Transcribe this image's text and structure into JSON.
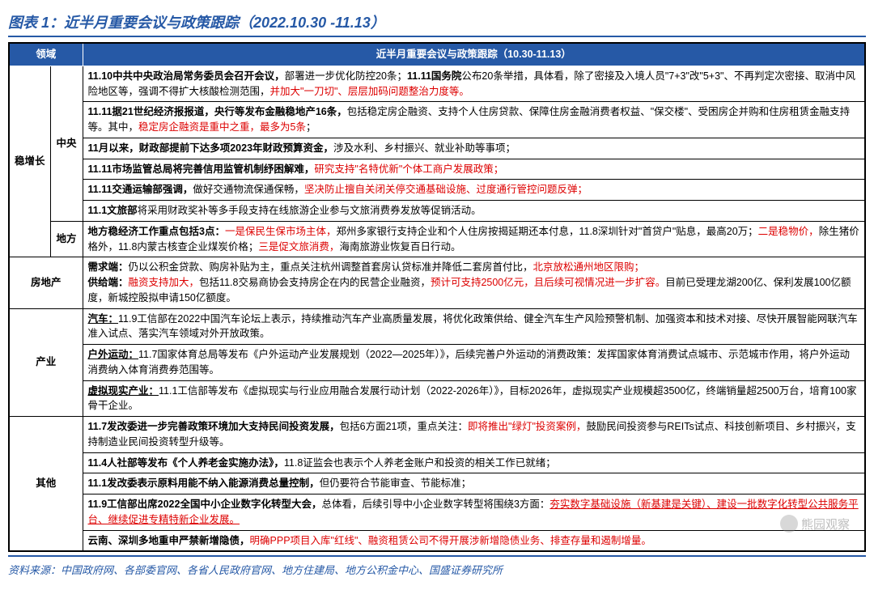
{
  "title": "图表 1：近半月重要会议与政策跟踪（2022.10.30 -11.13）",
  "header": {
    "col1": "领域",
    "col2": "近半月重要会议与政策跟踪（10.30-11.13）"
  },
  "source": "资料来源：中国政府网、各部委官网、各省人民政府官网、地方住建局、地方公积金中心、国盛证券研究所",
  "watermark": "熊园观察",
  "cat": {
    "wzz": "稳增长",
    "zy": "中央",
    "df": "地方",
    "fdc": "房地产",
    "cy": "产业",
    "qt": "其他"
  },
  "rows": {
    "zy1_b1": "11.10中共中央政治局常务委员会召开会议，",
    "zy1_t1": "部署进一步优化防控20条；",
    "zy1_b2": "11.11国务院",
    "zy1_t2": "公布20条举措，具体看，除了密接及入境人员\"7+3\"改\"5+3\"、不再判定次密接、取消中风险地区等，强调不得扩大核酸检测范围，",
    "zy1_r1": "并加大\"一刀切\"、层层加码问题整治力度等。",
    "zy2_b1": "11.11据21世纪经济报报道，央行等发布金融稳地产16条，",
    "zy2_t1": "包括稳定房企融资、支持个人住房贷款、保障住房金融消费者权益、\"保交楼\"、受困房企并购和住房租赁金融支持等。其中，",
    "zy2_r1": "稳定房企融资是重中之重，最多为5条",
    "zy2_t2": "；",
    "zy3_b1": "11月以来，财政部提前下达多项2023年财政预算资金，",
    "zy3_t1": "涉及水利、乡村振兴、就业补助等事项；",
    "zy4_b1": "11.11市场监管总局将完善信用监管机制纾困解难，",
    "zy4_r1": "研究支持\"名特优新\"个体工商户发展政策；",
    "zy5_b1": "11.11交通运输部强调，",
    "zy5_t1": "做好交通物流保通保畅，",
    "zy5_r1": "坚决防止擅自关闭关停交通基础设施、过度通行管控问题反弹；",
    "zy6_b1": "11.1文旅部",
    "zy6_t1": "将采用财政奖补等多手段支持在线旅游企业参与文旅消费券发放等促销活动。",
    "df1_b1": "地方稳经济工作重点包括3点：",
    "df1_r1": "一是保民生保市场主体，",
    "df1_t1": "郑州多家银行支持企业和个人住房按揭延期还本付息，11.8深圳针对\"首贷户\"贴息，最高20万；",
    "df1_r2": "二是稳物价，",
    "df1_t2": "除生猪价格外，11.8内蒙古核查企业煤炭价格；",
    "df1_r3": "三是促文旅消费，",
    "df1_t3": "海南旅游业恢复百日行动。",
    "fdc_b1": "需求端：",
    "fdc_t1": "仍以公积金贷款、购房补贴为主，重点关注杭州调整首套房认贷标准并降低二套房首付比，",
    "fdc_r1": "北京放松通州地区限购；",
    "fdc_b2": "供给端：",
    "fdc_r2": "融资支持加大，",
    "fdc_t2": "包括11.8交易商协会支持房企在内的民营企业融资，",
    "fdc_r3": "预计可支持2500亿元，且后续可视情况进一步扩容。",
    "fdc_t3": "目前已受理龙湖200亿、保利发展100亿额度，新城控股拟申请150亿额度。",
    "cy1_bu": "汽车：",
    "cy1_t1": "11.9工信部在2022中国汽车论坛上表示，持续推动汽车产业高质量发展，将优化政策供给、健全汽车生产风险预警机制、加强资本和技术对接、尽快开展智能网联汽车准入试点、落实汽车领域对外开放政策。",
    "cy2_bu": "户外运动：",
    "cy2_t1": "11.7国家体育总局等发布《户外运动产业发展规划（2022—2025年）》，后续完善户外运动的消费政策：发挥国家体育消费试点城市、示范城市作用，将户外运动消费纳入体育消费券范围等。",
    "cy3_bu": "虚拟现实产业：",
    "cy3_t1": "11.1工信部等发布《虚拟现实与行业应用融合发展行动计划（2022-2026年）》，目标2026年，虚拟现实产业规模超3500亿，终端销量超2500万台，培育100家骨干企业。",
    "qt1_b1": "11.7发改委进一步完善政策环境加大支持民间投资发展，",
    "qt1_t1": "包括6方面21项，重点关注：",
    "qt1_r1": "即将推出\"绿灯\"投资案例，",
    "qt1_t2": "鼓励民间投资参与REITs试点、科技创新项目、乡村振兴，支持制造业民间投资转型升级等。",
    "qt2_b1": "11.4人社部等发布《个人养老金实施办法》，",
    "qt2_t1": "11.8证监会也表示个人养老金账户和投资的相关工作已就绪；",
    "qt3_b1": "11.1发改委表示原料用能不纳入能源消费总量控制，",
    "qt3_t1": "但仍要符合节能审查、节能标准；",
    "qt4_b1": "11.9工信部出席2022全国中小企业数字化转型大会，",
    "qt4_t1": "总体看，后续引导中小企业数字转型将围绕3方面：",
    "qt4_r1": "夯实数字基础设施（新基建是关键）、建设一批数字化转型公共服务平台、继续促进专精特新企业发展。",
    "qt5_b1": "云南、深圳多地重申严禁新增隐债，",
    "qt5_r1": "明确PPP项目入库\"红线\"、融资租赁公司不得开展涉新增隐债业务、排查存量和遏制增量。"
  }
}
